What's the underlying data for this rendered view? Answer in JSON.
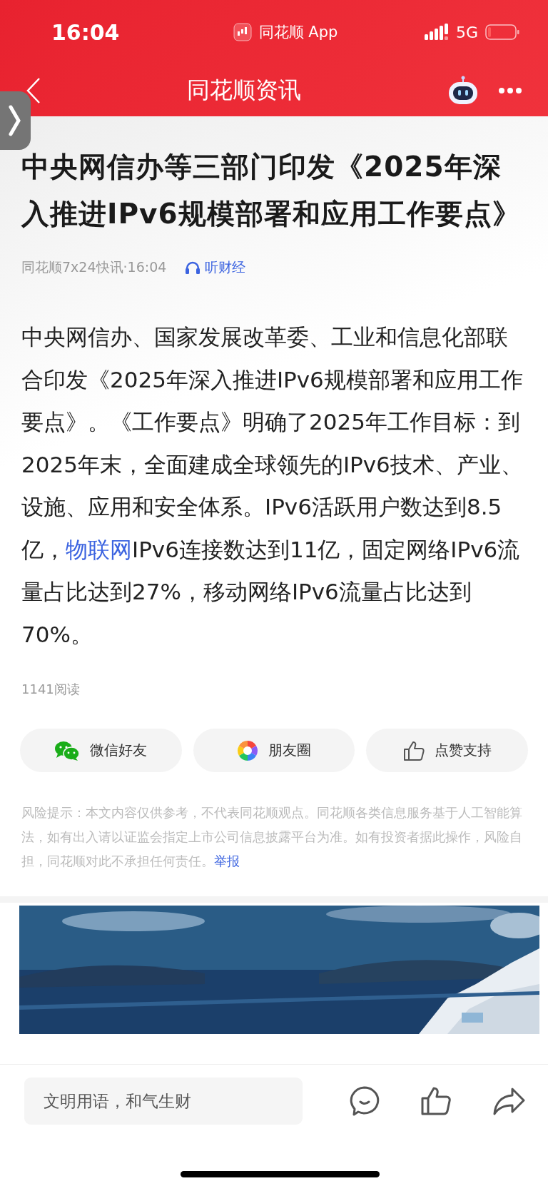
{
  "status_bar": {
    "time": "16:04",
    "app": "同花顺 App",
    "network": "5G"
  },
  "nav": {
    "title": "同花顺资讯"
  },
  "article": {
    "title": "中央网信办等三部门印发《2025年深入推进IPv6规模部署和应用工作要点》",
    "source": "同花顺7x24快讯·16:04",
    "listen": "听财经",
    "body": [
      {
        "kind": "text",
        "text": "中央网信办、国家发展改革委、工业和信息化部联合印发《2025年深入推进IPv6规模部署和应用工作要点》。《工作要点》明确了2025年工作目标：到2025年末，全面建成全球领先的IPv6技术、产业、设施、应用和安全体系。IPv6活跃用户数达到8.5亿，"
      },
      {
        "kind": "link",
        "text": "物联网"
      },
      {
        "kind": "text",
        "text": "IPv6连接数达到11亿，固定网络IPv6流量占比达到27%，移动网络IPv6流量占比达到70%。"
      }
    ],
    "reads": "1141阅读"
  },
  "share_buttons": [
    {
      "kind": "wechat",
      "label": "微信好友"
    },
    {
      "kind": "moments",
      "label": "朋友圈"
    },
    {
      "kind": "like",
      "label": "点赞支持"
    }
  ],
  "disclaimer": {
    "text": "风险提示：本文内容仅供参考，不代表同花顺观点。同花顺各类信息服务基于人工智能算法，如有出入请以证监会指定上市公司信息披露平台为准。如有投资者据此操作，风险自担，同花顺对此不承担任何责任。",
    "report": "举报"
  },
  "comment_bar": {
    "placeholder": "文明用语，和气生财"
  }
}
